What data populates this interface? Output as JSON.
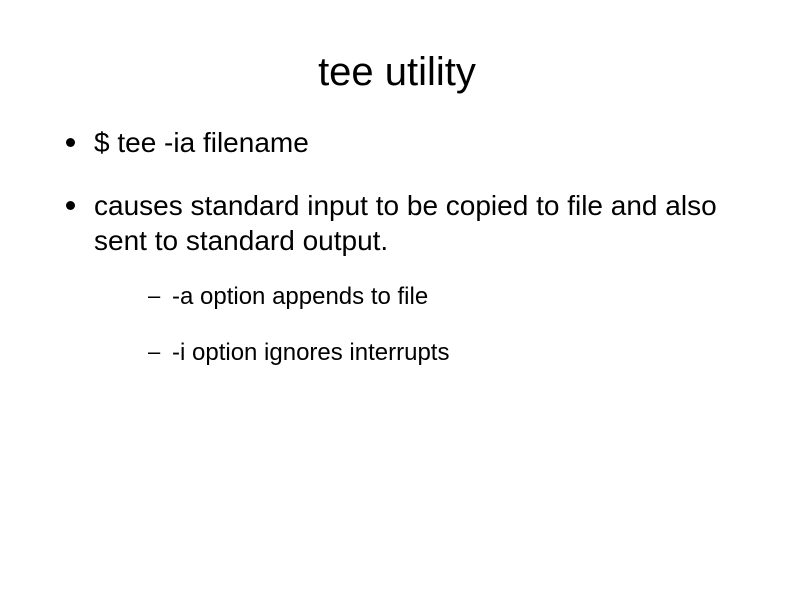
{
  "slide": {
    "title": "tee utility",
    "bullets": [
      {
        "text": "$ tee -ia filename"
      },
      {
        "text": "causes standard input to be copied to file and also sent to standard output.",
        "sub": [
          {
            "text": "-a option appends to file"
          },
          {
            "text": "-i option ignores interrupts"
          }
        ]
      }
    ]
  }
}
